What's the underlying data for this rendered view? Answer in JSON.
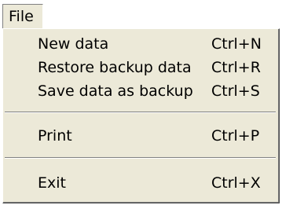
{
  "menu": {
    "title": "File",
    "items": [
      {
        "label": "New data",
        "shortcut": "Ctrl+N"
      },
      {
        "label": "Restore backup data",
        "shortcut": "Ctrl+R"
      },
      {
        "label": "Save data as backup",
        "shortcut": "Ctrl+S"
      },
      {
        "label": "Print",
        "shortcut": "Ctrl+P"
      },
      {
        "label": "Exit",
        "shortcut": "Ctrl+X"
      }
    ]
  },
  "colors": {
    "menu_background": "#ece9d8",
    "page_background": "#ffffff",
    "text": "#000000",
    "separator": "#808080"
  }
}
